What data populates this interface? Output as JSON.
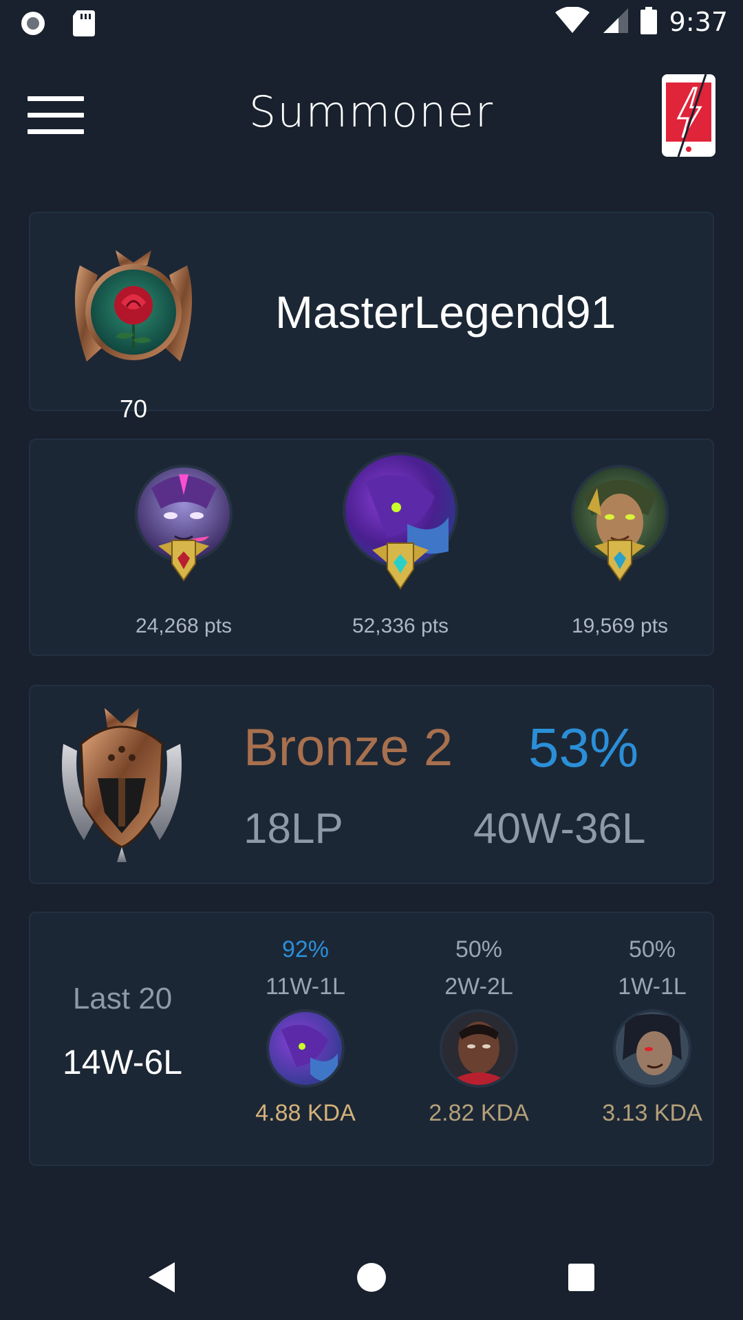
{
  "status_bar": {
    "time": "9:37",
    "icons": [
      "record-icon",
      "sd-card-icon",
      "wifi-icon",
      "signal-icon",
      "battery-icon"
    ]
  },
  "app_bar": {
    "title": "Summoner",
    "menu_icon": "hamburger-menu-icon",
    "action_icon": "phone-boost-icon"
  },
  "profile": {
    "summoner_name": "MasterLegend91",
    "level": "70",
    "icon": "rose-profile-icon"
  },
  "mastery": [
    {
      "points": "24,268 pts",
      "champion_icon": "champion-portrait-purple-icon"
    },
    {
      "points": "52,336 pts",
      "champion_icon": "champion-portrait-void-icon"
    },
    {
      "points": "19,569 pts",
      "champion_icon": "champion-portrait-green-icon"
    }
  ],
  "ranked": {
    "tier": "Bronze 2",
    "lp": "18LP",
    "winrate": "53%",
    "record": "40W-36L",
    "emblem_icon": "bronze-emblem-icon"
  },
  "recent": {
    "label": "Last 20",
    "record": "14W-6L",
    "champions": [
      {
        "winrate": "92%",
        "record": "11W-1L",
        "kda": "4.88 KDA"
      },
      {
        "winrate": "50%",
        "record": "2W-2L",
        "kda": "2.82 KDA"
      },
      {
        "winrate": "50%",
        "record": "1W-1L",
        "kda": "3.13 KDA"
      }
    ]
  },
  "colors": {
    "background": "#18212d",
    "card": "#1c2735",
    "bronze": "#a8704e",
    "blue_accent": "#2b8fd8",
    "muted": "#8f9aa7",
    "kda_gold": "#d4b27a"
  },
  "nav_bar": {
    "icons": [
      "back-icon",
      "home-icon",
      "recents-icon"
    ]
  }
}
